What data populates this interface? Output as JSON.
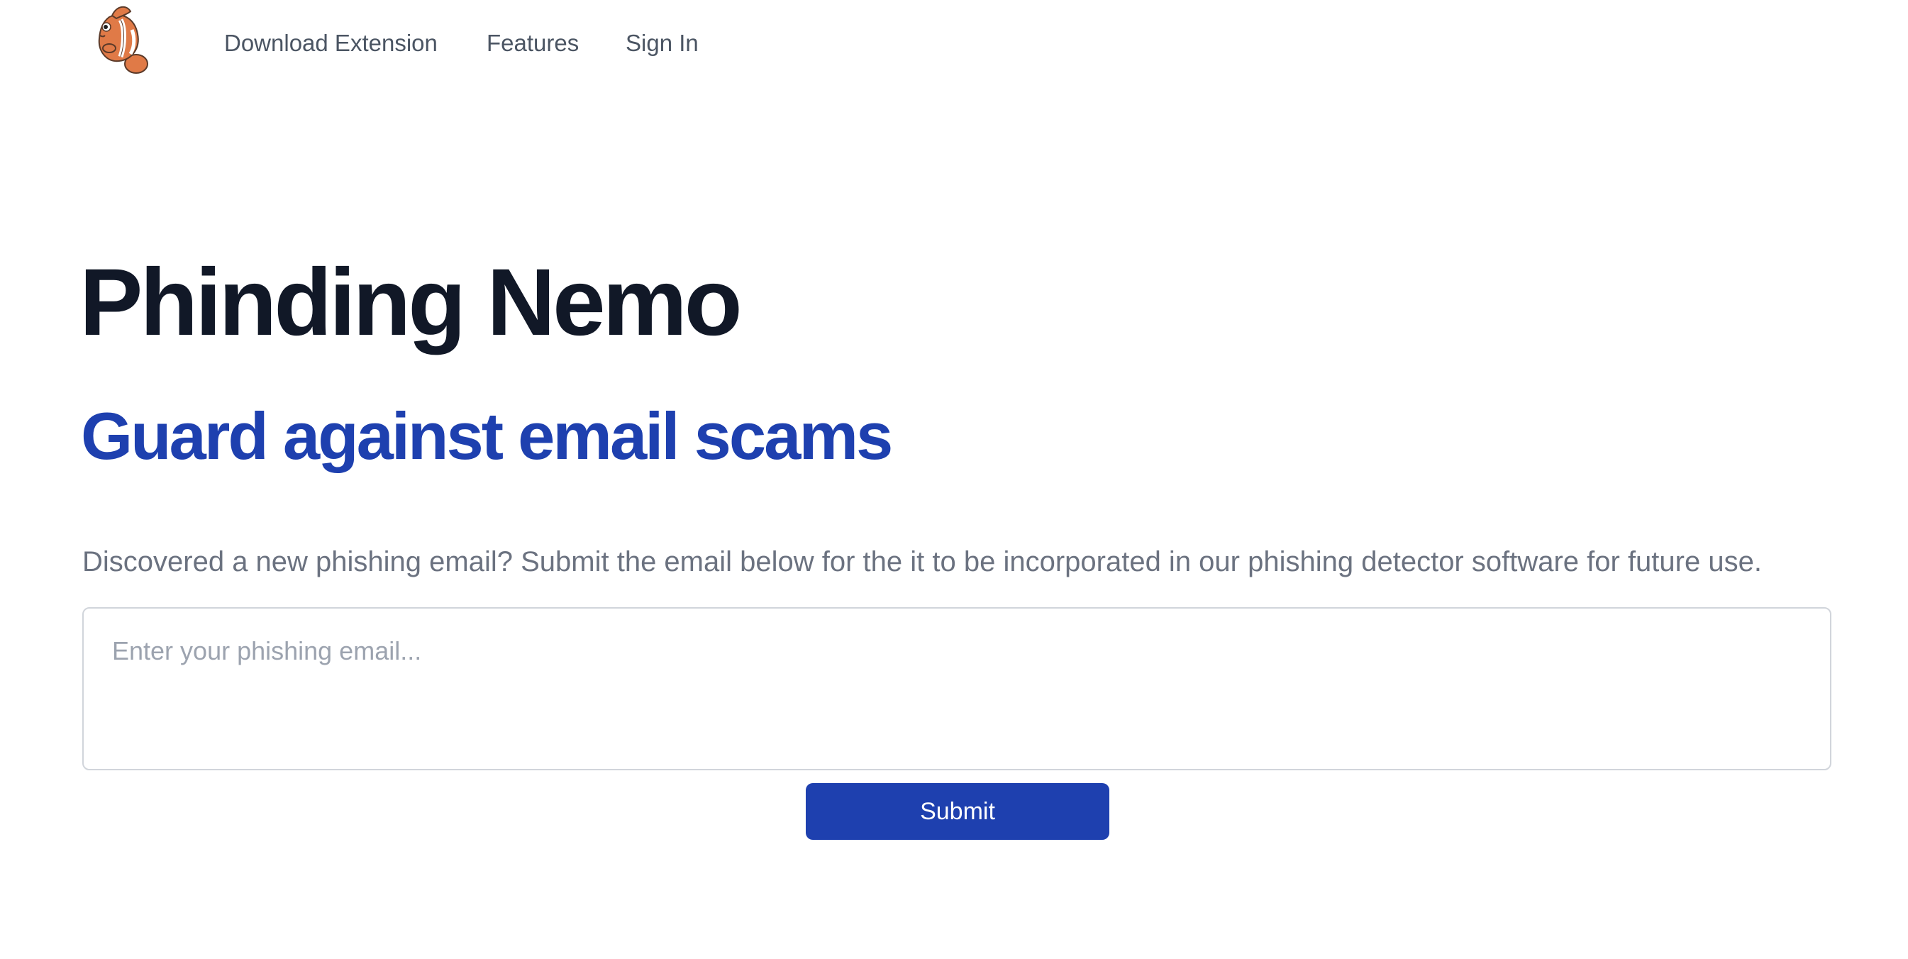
{
  "nav": {
    "logo_icon": "clownfish-logo-icon",
    "links": [
      {
        "label": "Download Extension"
      },
      {
        "label": "Features"
      },
      {
        "label": "Sign In"
      }
    ]
  },
  "hero": {
    "title": "Phinding Nemo",
    "subtitle": "Guard against email scams",
    "description": "Discovered a new phishing email? Submit the email below for the it to be incorporated in our phishing detector software for future use."
  },
  "form": {
    "email_placeholder": "Enter your phishing email...",
    "email_value": "",
    "submit_label": "Submit"
  },
  "colors": {
    "primary": "#1e40af",
    "heading": "#111827",
    "muted_text": "#6b7280",
    "nav_text": "#4b5563",
    "logo_orange": "#e07a47"
  }
}
